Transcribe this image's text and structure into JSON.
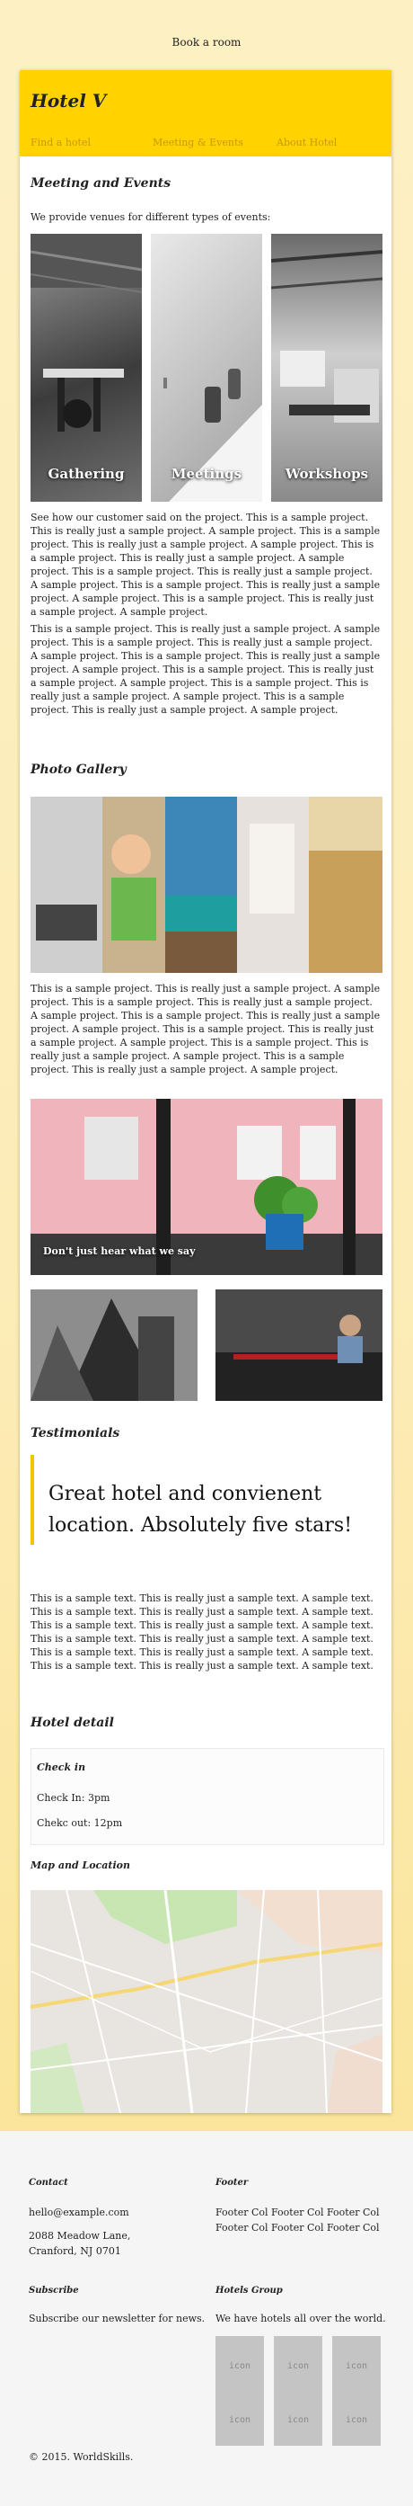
{
  "topbar": {
    "book_label": "Book a room"
  },
  "header": {
    "title": "Hotel V",
    "nav": [
      "Find a hotel",
      "Meeting & Events",
      "About Hotel"
    ]
  },
  "meetings": {
    "heading": "Meeting and Events",
    "intro": "We provide venues for different types of events:",
    "cards": [
      "Gathering",
      "Meetings",
      "Workshops"
    ],
    "para1": "See how our customer said on the project. This is a sample project. This is really just a sample project. A sample project. This is a sample project. This is really just a sample project. A sample project. This is a sample project. This is really just a sample project. A sample project. This is a sample project. This is really just a sample project. A sample project. This is a sample project. This is really just a sample project. A sample project. This is a sample project. This is really just a sample project. A sample project.",
    "para2": "This is a sample project. This is really just a sample project. A sample project. This is a sample project. This is really just a sample project. A sample project. This is a sample project. This is really just a sample project. A sample project. This is a sample project. This is really just a sample project. A sample project. This is a sample project. This is really just a sample project. A sample project. This is a sample project. This is really just a sample project. A sample project."
  },
  "gallery": {
    "heading": "Photo Gallery",
    "para": "This is a sample project. This is really just a sample project. A sample project. This is a sample project. This is really just a sample project. A sample project. This is a sample project. This is really just a sample project. A sample project. This is a sample project. This is really just a sample project. A sample project. This is a sample project. This is really just a sample project. A sample project. This is a sample project. This is really just a sample project. A sample project.",
    "caption": "Don't just hear what we say"
  },
  "testimonials": {
    "heading": "Testimonials",
    "quote": "Great hotel and convienent location. Absolutely five stars!",
    "para": "This is a sample text. This is really just a sample text. A sample text. This is a sample text. This is really just a sample text. A sample text. This is a sample text. This is really just a sample text. A sample text. This is a sample text. This is really just a sample text. A sample text. This is a sample text. This is really just a sample text. A sample text. This is a sample text. This is really just a sample text. A sample text."
  },
  "detail": {
    "heading": "Hotel detail",
    "checkin_label": "Check in",
    "checkin": "Check In: 3pm",
    "checkout": "Chekc out: 12pm",
    "map_heading": "Map and Location"
  },
  "footer": {
    "contact_heading": "Contact",
    "email": "hello@example.com",
    "address1": "2088 Meadow Lane,",
    "address2": "Cranford, NJ 0701",
    "footer_heading": "Footer",
    "footer_line1": "Footer Col Footer Col Footer Col",
    "footer_line2": "Footer Col Footer Col Footer Col",
    "subscribe_heading": "Subscribe",
    "subscribe_text": "Subscribe our newsletter for news.",
    "group_heading": "Hotels Group",
    "group_text": "We have hotels all over the world.",
    "icon_label": "icon",
    "copyright": "© 2015. WorldSkills."
  },
  "colors": {
    "brand": "#ffd200",
    "accent": "#f2c400"
  }
}
